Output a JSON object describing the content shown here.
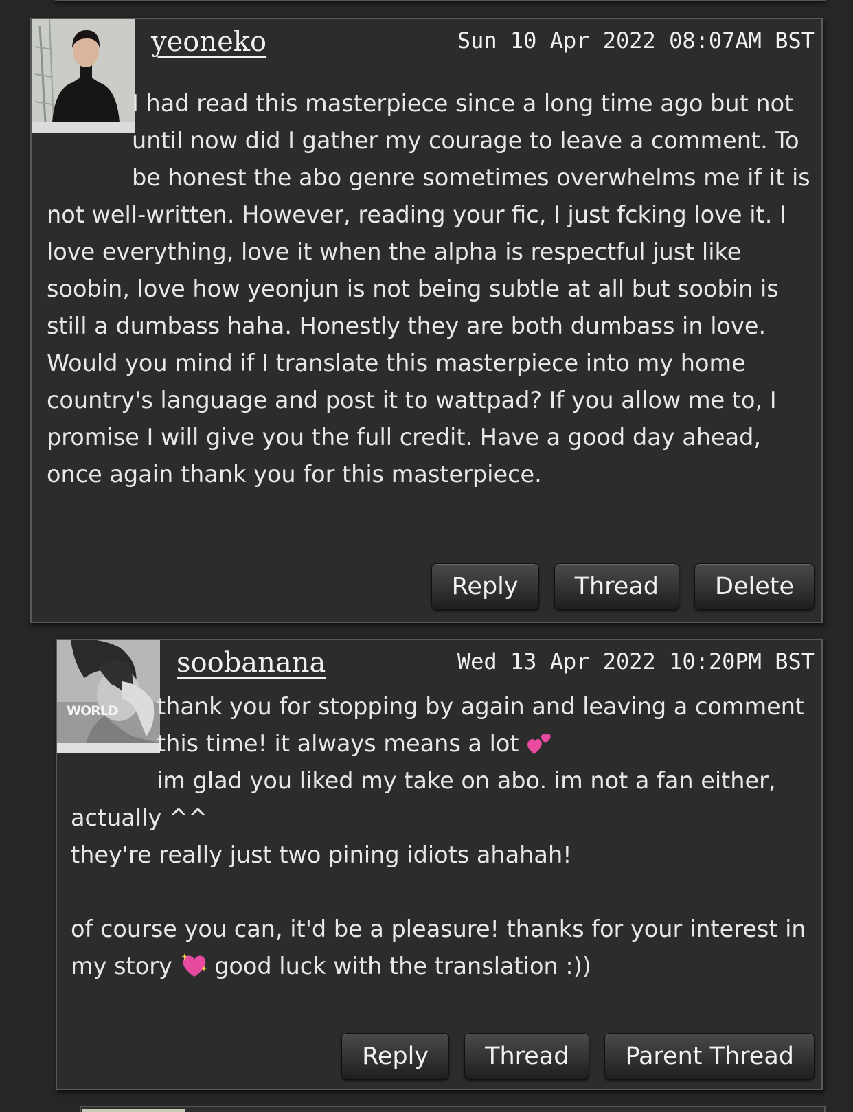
{
  "comments": [
    {
      "username": "yeoneko",
      "timestamp": "Sun 10 Apr 2022 08:07AM BST",
      "text": "I had read this masterpiece since a long time ago but not until now did I gather my courage to leave a comment. To be honest the abo genre sometimes overwhelms me if it is not well-written. However, reading your fic, I just fcking love it. I love everything, love it when the alpha is respectful just like soobin, love how yeonjun is not being subtle at all but soobin is still a dumbass haha. Honestly they are both dumbass in love.\nWould you mind if I translate this masterpiece into my home country's language and post it to wattpad? If you allow me to, I promise I will give you the full credit. Have a good day ahead, once again thank you for this masterpiece.",
      "buttons": {
        "reply": "Reply",
        "thread": "Thread",
        "delete": "Delete"
      }
    },
    {
      "username": "soobanana",
      "timestamp": "Wed 13 Apr 2022 10:20PM BST",
      "avatar_text": "WORLD",
      "text_part1": "thank you for stopping by again and leaving a comment this time! it always means a lot ",
      "text_part2": "\nim glad you liked my take on abo. im not a fan either, actually ^^\nthey're really just two pining idiots ahahah!\n\nof course you can, it'd be a pleasure! thanks for your interest in my story ",
      "text_part3": " good luck with the translation :))",
      "buttons": {
        "reply": "Reply",
        "thread": "Thread",
        "parent_thread": "Parent Thread"
      }
    }
  ],
  "icons": {
    "two_hearts": "two-hearts-emoji",
    "sparkling_heart": "sparkling-heart-emoji"
  },
  "colors": {
    "background": "#262626",
    "panel": "#2c2c2c",
    "border": "#5a5a5a",
    "text": "#e8e8e8",
    "heart_pink": "#e84aa0"
  }
}
